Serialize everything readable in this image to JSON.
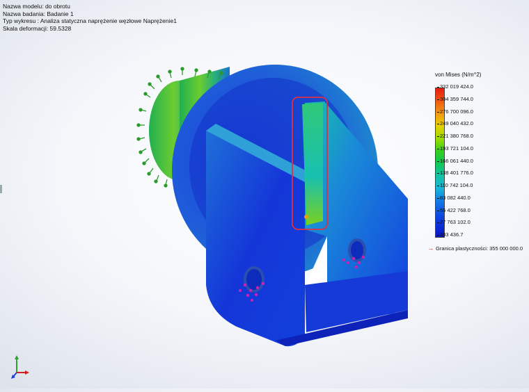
{
  "info": {
    "model_name": "Nazwa modelu: do obrotu",
    "study_name": "Nazwa badania: Badanie 1",
    "plot_type": "Typ wykresu : Analiza statyczna naprężenie węzłowe Naprężenie1",
    "deformation_scale": "Skala deformacji: 59.5328"
  },
  "legend": {
    "title": "von Mises (N/m^2)",
    "ticks": [
      "332 019 424.0",
      "304 359 744.0",
      "276 700 096.0",
      "249 040 432.0",
      "221 380 768.0",
      "193 721 104.0",
      "166 061 440.0",
      "138 401 776.0",
      "110 742 104.0",
      "83 082 440.0",
      "55 422 768.0",
      "27 763 102.0",
      "103 436.7"
    ],
    "yield": "Granica plastyczności: 355 000 000.0"
  },
  "colors": {
    "highlight": "#e03040",
    "fixture": "#2a9a2a",
    "load": "#d020b0"
  }
}
